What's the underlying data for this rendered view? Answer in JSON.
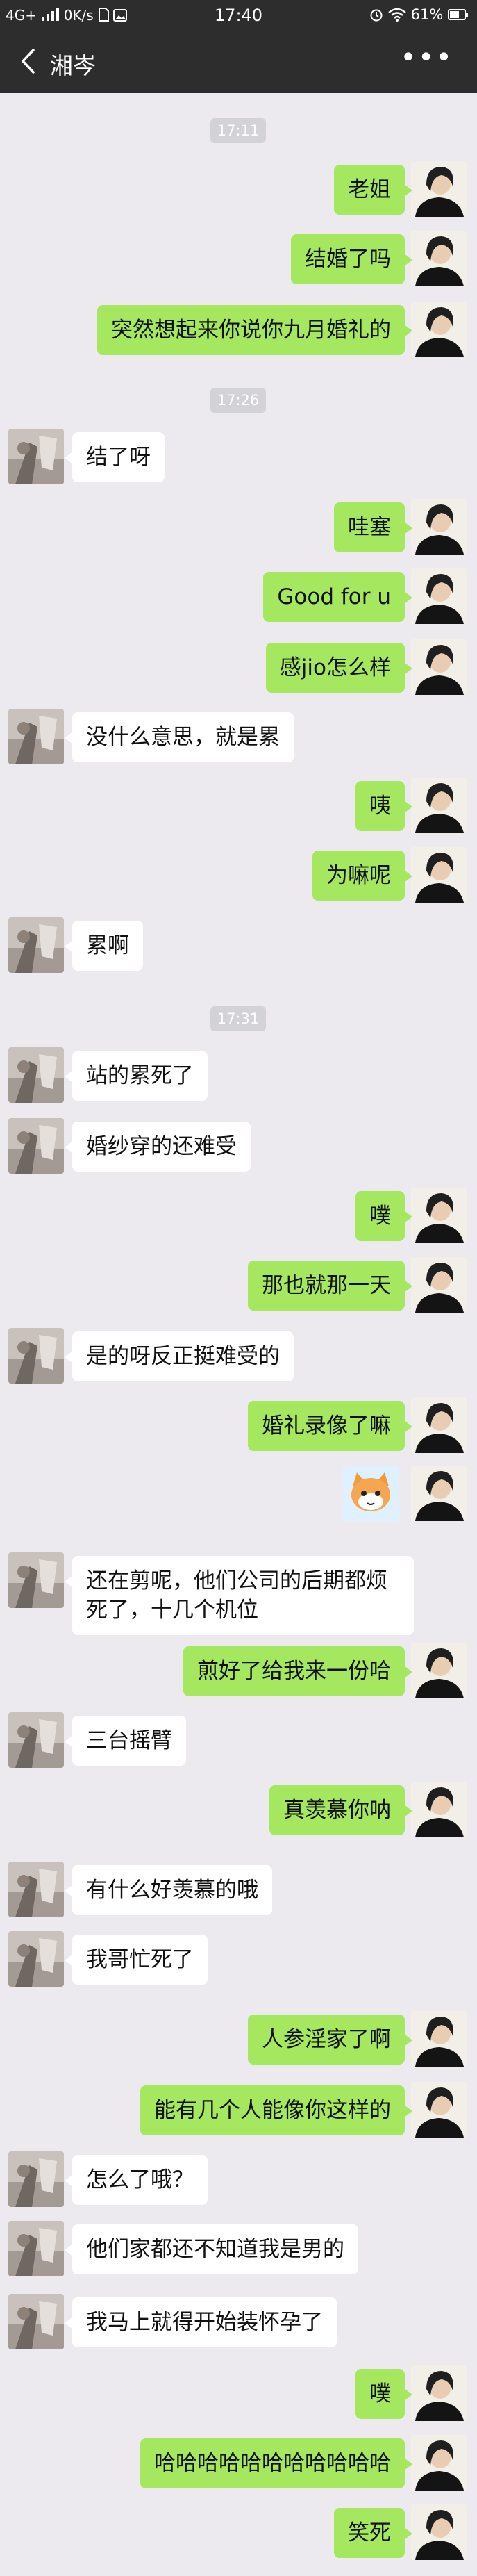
{
  "status_bar": {
    "network": "4G+",
    "speed": "0K/s",
    "time": "17:40",
    "battery": "61%"
  },
  "header": {
    "contact_name": "湘岑",
    "icons": [
      "back-arrow-icon",
      "more-icon"
    ]
  },
  "colors": {
    "bar_bg": "#2d2d2d",
    "chat_bg": "#eceaef",
    "self_bubble": "#a5e75f",
    "other_bubble": "#ffffff",
    "timestamp_bg": "#d3d2d6"
  },
  "timestamps": [
    "17:11",
    "17:26",
    "17:31"
  ],
  "messages": [
    {
      "side": "right",
      "text": "老姐"
    },
    {
      "side": "right",
      "text": "结婚了吗"
    },
    {
      "side": "right",
      "text": "突然想起来你说你九月婚礼的"
    },
    {
      "side": "left",
      "text": "结了呀"
    },
    {
      "side": "right",
      "text": "哇塞"
    },
    {
      "side": "right",
      "text": "Good for u"
    },
    {
      "side": "right",
      "text": "感jio怎么样"
    },
    {
      "side": "left",
      "text": "没什么意思，就是累"
    },
    {
      "side": "right",
      "text": "咦"
    },
    {
      "side": "right",
      "text": "为嘛呢"
    },
    {
      "side": "left",
      "text": "累啊"
    },
    {
      "side": "left",
      "text": "站的累死了"
    },
    {
      "side": "left",
      "text": "婚纱穿的还难受"
    },
    {
      "side": "right",
      "text": "噗"
    },
    {
      "side": "right",
      "text": "那也就那一天"
    },
    {
      "side": "left",
      "text": "是的呀反正挺难受的"
    },
    {
      "side": "right",
      "text": "婚礼录像了嘛"
    },
    {
      "side": "right",
      "text": "",
      "sticker": "cat-sticker"
    },
    {
      "side": "left",
      "text": "还在剪呢，他们公司的后期都烦死了，十几个机位"
    },
    {
      "side": "right",
      "text": "煎好了给我来一份哈"
    },
    {
      "side": "left",
      "text": "三台摇臂"
    },
    {
      "side": "right",
      "text": "真羡慕你呐"
    },
    {
      "side": "left",
      "text": "有什么好羡慕的哦"
    },
    {
      "side": "left",
      "text": "我哥忙死了"
    },
    {
      "side": "right",
      "text": "人参淫家了啊"
    },
    {
      "side": "right",
      "text": "能有几个人能像你这样的"
    },
    {
      "side": "left",
      "text": "怎么了哦？"
    },
    {
      "side": "left",
      "text": "他们家都还不知道我是男的"
    },
    {
      "side": "left",
      "text": "我马上就得开始装怀孕了"
    },
    {
      "side": "right",
      "text": "噗"
    },
    {
      "side": "right",
      "text": "哈哈哈哈哈哈哈哈哈哈哈"
    },
    {
      "side": "right",
      "text": "笑死"
    }
  ]
}
